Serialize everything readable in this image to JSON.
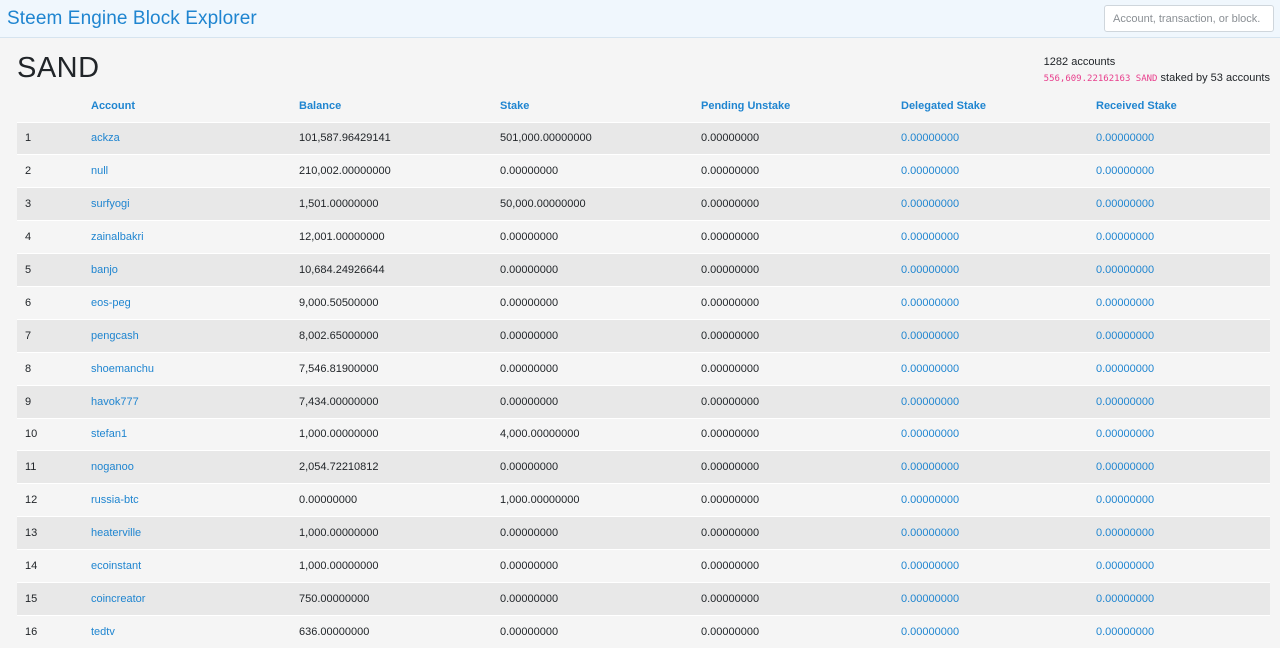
{
  "navbar": {
    "brand": "Steem Engine Block Explorer",
    "search_placeholder": "Account, transaction, or block."
  },
  "token": {
    "symbol": "SAND",
    "accounts_count": "1282 accounts",
    "staked_amount": "556,609.22162163 SAND",
    "staked_by": "staked by 53 accounts"
  },
  "table": {
    "headers": [
      "",
      "Account",
      "Balance",
      "Stake",
      "Pending Unstake",
      "Delegated Stake",
      "Received Stake"
    ],
    "rows": [
      {
        "rank": "1",
        "account": "ackza",
        "balance": "101,587.96429141",
        "stake": "501,000.00000000",
        "pending": "0.00000000",
        "delegated": "0.00000000",
        "received": "0.00000000"
      },
      {
        "rank": "2",
        "account": "null",
        "balance": "210,002.00000000",
        "stake": "0.00000000",
        "pending": "0.00000000",
        "delegated": "0.00000000",
        "received": "0.00000000"
      },
      {
        "rank": "3",
        "account": "surfyogi",
        "balance": "1,501.00000000",
        "stake": "50,000.00000000",
        "pending": "0.00000000",
        "delegated": "0.00000000",
        "received": "0.00000000"
      },
      {
        "rank": "4",
        "account": "zainalbakri",
        "balance": "12,001.00000000",
        "stake": "0.00000000",
        "pending": "0.00000000",
        "delegated": "0.00000000",
        "received": "0.00000000"
      },
      {
        "rank": "5",
        "account": "banjo",
        "balance": "10,684.24926644",
        "stake": "0.00000000",
        "pending": "0.00000000",
        "delegated": "0.00000000",
        "received": "0.00000000"
      },
      {
        "rank": "6",
        "account": "eos-peg",
        "balance": "9,000.50500000",
        "stake": "0.00000000",
        "pending": "0.00000000",
        "delegated": "0.00000000",
        "received": "0.00000000"
      },
      {
        "rank": "7",
        "account": "pengcash",
        "balance": "8,002.65000000",
        "stake": "0.00000000",
        "pending": "0.00000000",
        "delegated": "0.00000000",
        "received": "0.00000000"
      },
      {
        "rank": "8",
        "account": "shoemanchu",
        "balance": "7,546.81900000",
        "stake": "0.00000000",
        "pending": "0.00000000",
        "delegated": "0.00000000",
        "received": "0.00000000"
      },
      {
        "rank": "9",
        "account": "havok777",
        "balance": "7,434.00000000",
        "stake": "0.00000000",
        "pending": "0.00000000",
        "delegated": "0.00000000",
        "received": "0.00000000"
      },
      {
        "rank": "10",
        "account": "stefan1",
        "balance": "1,000.00000000",
        "stake": "4,000.00000000",
        "pending": "0.00000000",
        "delegated": "0.00000000",
        "received": "0.00000000"
      },
      {
        "rank": "11",
        "account": "noganoo",
        "balance": "2,054.72210812",
        "stake": "0.00000000",
        "pending": "0.00000000",
        "delegated": "0.00000000",
        "received": "0.00000000"
      },
      {
        "rank": "12",
        "account": "russia-btc",
        "balance": "0.00000000",
        "stake": "1,000.00000000",
        "pending": "0.00000000",
        "delegated": "0.00000000",
        "received": "0.00000000"
      },
      {
        "rank": "13",
        "account": "heaterville",
        "balance": "1,000.00000000",
        "stake": "0.00000000",
        "pending": "0.00000000",
        "delegated": "0.00000000",
        "received": "0.00000000"
      },
      {
        "rank": "14",
        "account": "ecoinstant",
        "balance": "1,000.00000000",
        "stake": "0.00000000",
        "pending": "0.00000000",
        "delegated": "0.00000000",
        "received": "0.00000000"
      },
      {
        "rank": "15",
        "account": "coincreator",
        "balance": "750.00000000",
        "stake": "0.00000000",
        "pending": "0.00000000",
        "delegated": "0.00000000",
        "received": "0.00000000"
      },
      {
        "rank": "16",
        "account": "tedtv",
        "balance": "636.00000000",
        "stake": "0.00000000",
        "pending": "0.00000000",
        "delegated": "0.00000000",
        "received": "0.00000000"
      }
    ]
  },
  "colors": {
    "link": "#1f85d0",
    "navbar_bg": "#f0f7fd",
    "stripe": "#e8e8e8",
    "code_pink": "#e83e8c"
  }
}
